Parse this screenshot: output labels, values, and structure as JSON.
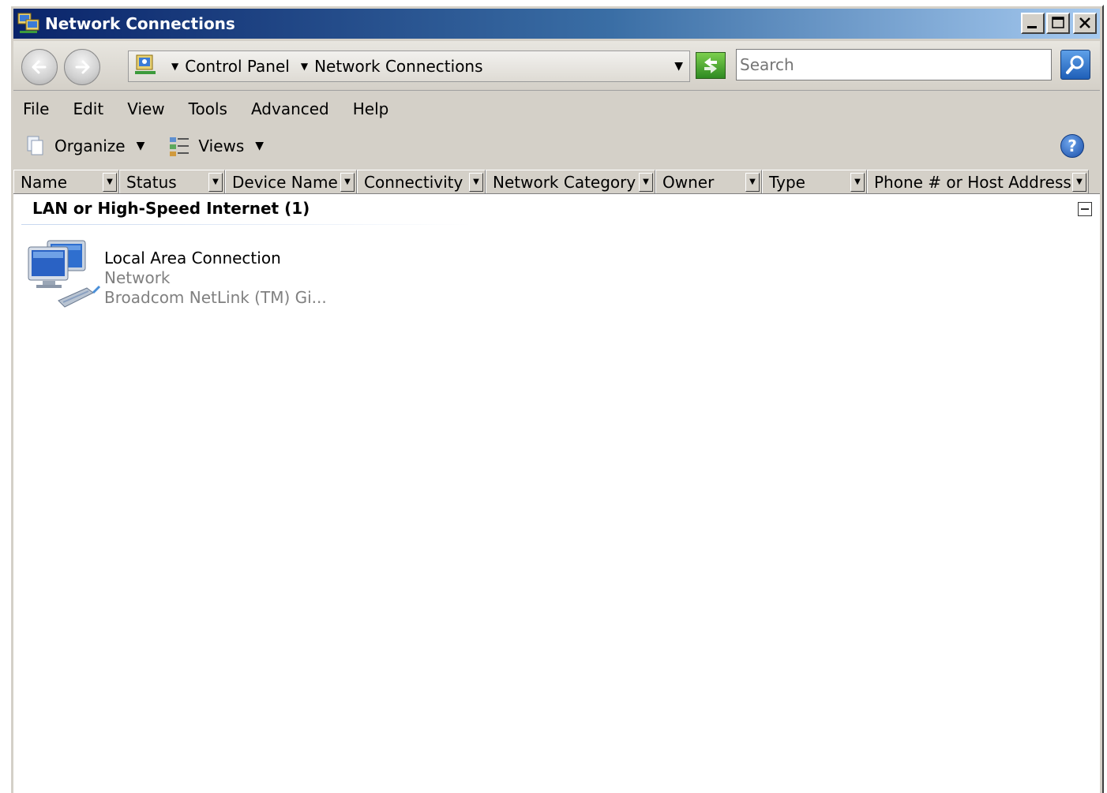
{
  "window": {
    "title": "Network Connections"
  },
  "address": {
    "breadcrumbs": [
      "Control Panel",
      "Network Connections"
    ],
    "search_placeholder": "Search"
  },
  "menu": {
    "items": [
      {
        "label": "File"
      },
      {
        "label": "Edit"
      },
      {
        "label": "View"
      },
      {
        "label": "Tools"
      },
      {
        "label": "Advanced"
      },
      {
        "label": "Help"
      }
    ]
  },
  "toolbar": {
    "organize_label": "Organize",
    "views_label": "Views"
  },
  "columns": [
    {
      "label": "Name"
    },
    {
      "label": "Status"
    },
    {
      "label": "Device Name"
    },
    {
      "label": "Connectivity"
    },
    {
      "label": "Network Category"
    },
    {
      "label": "Owner"
    },
    {
      "label": "Type"
    },
    {
      "label": "Phone # or Host Address"
    }
  ],
  "content": {
    "group_title": "LAN or High-Speed Internet (1)",
    "items": [
      {
        "name": "Local Area Connection",
        "status": "Network",
        "device": "Broadcom NetLink (TM) Gi..."
      }
    ]
  },
  "icons": {
    "title": "network-connections-icon",
    "back": "back-arrow-icon",
    "forward": "forward-arrow-icon",
    "address": "control-panel-icon",
    "go": "go-refresh-icon",
    "search": "search-icon",
    "organize": "organize-icon",
    "views": "views-icon",
    "help": "help-icon",
    "item": "network-adapter-icon"
  },
  "colors": {
    "title_gradient_start": "#0a246a",
    "title_gradient_end": "#a6caf0",
    "window_face": "#d4d0c8",
    "muted_text": "#808080"
  }
}
